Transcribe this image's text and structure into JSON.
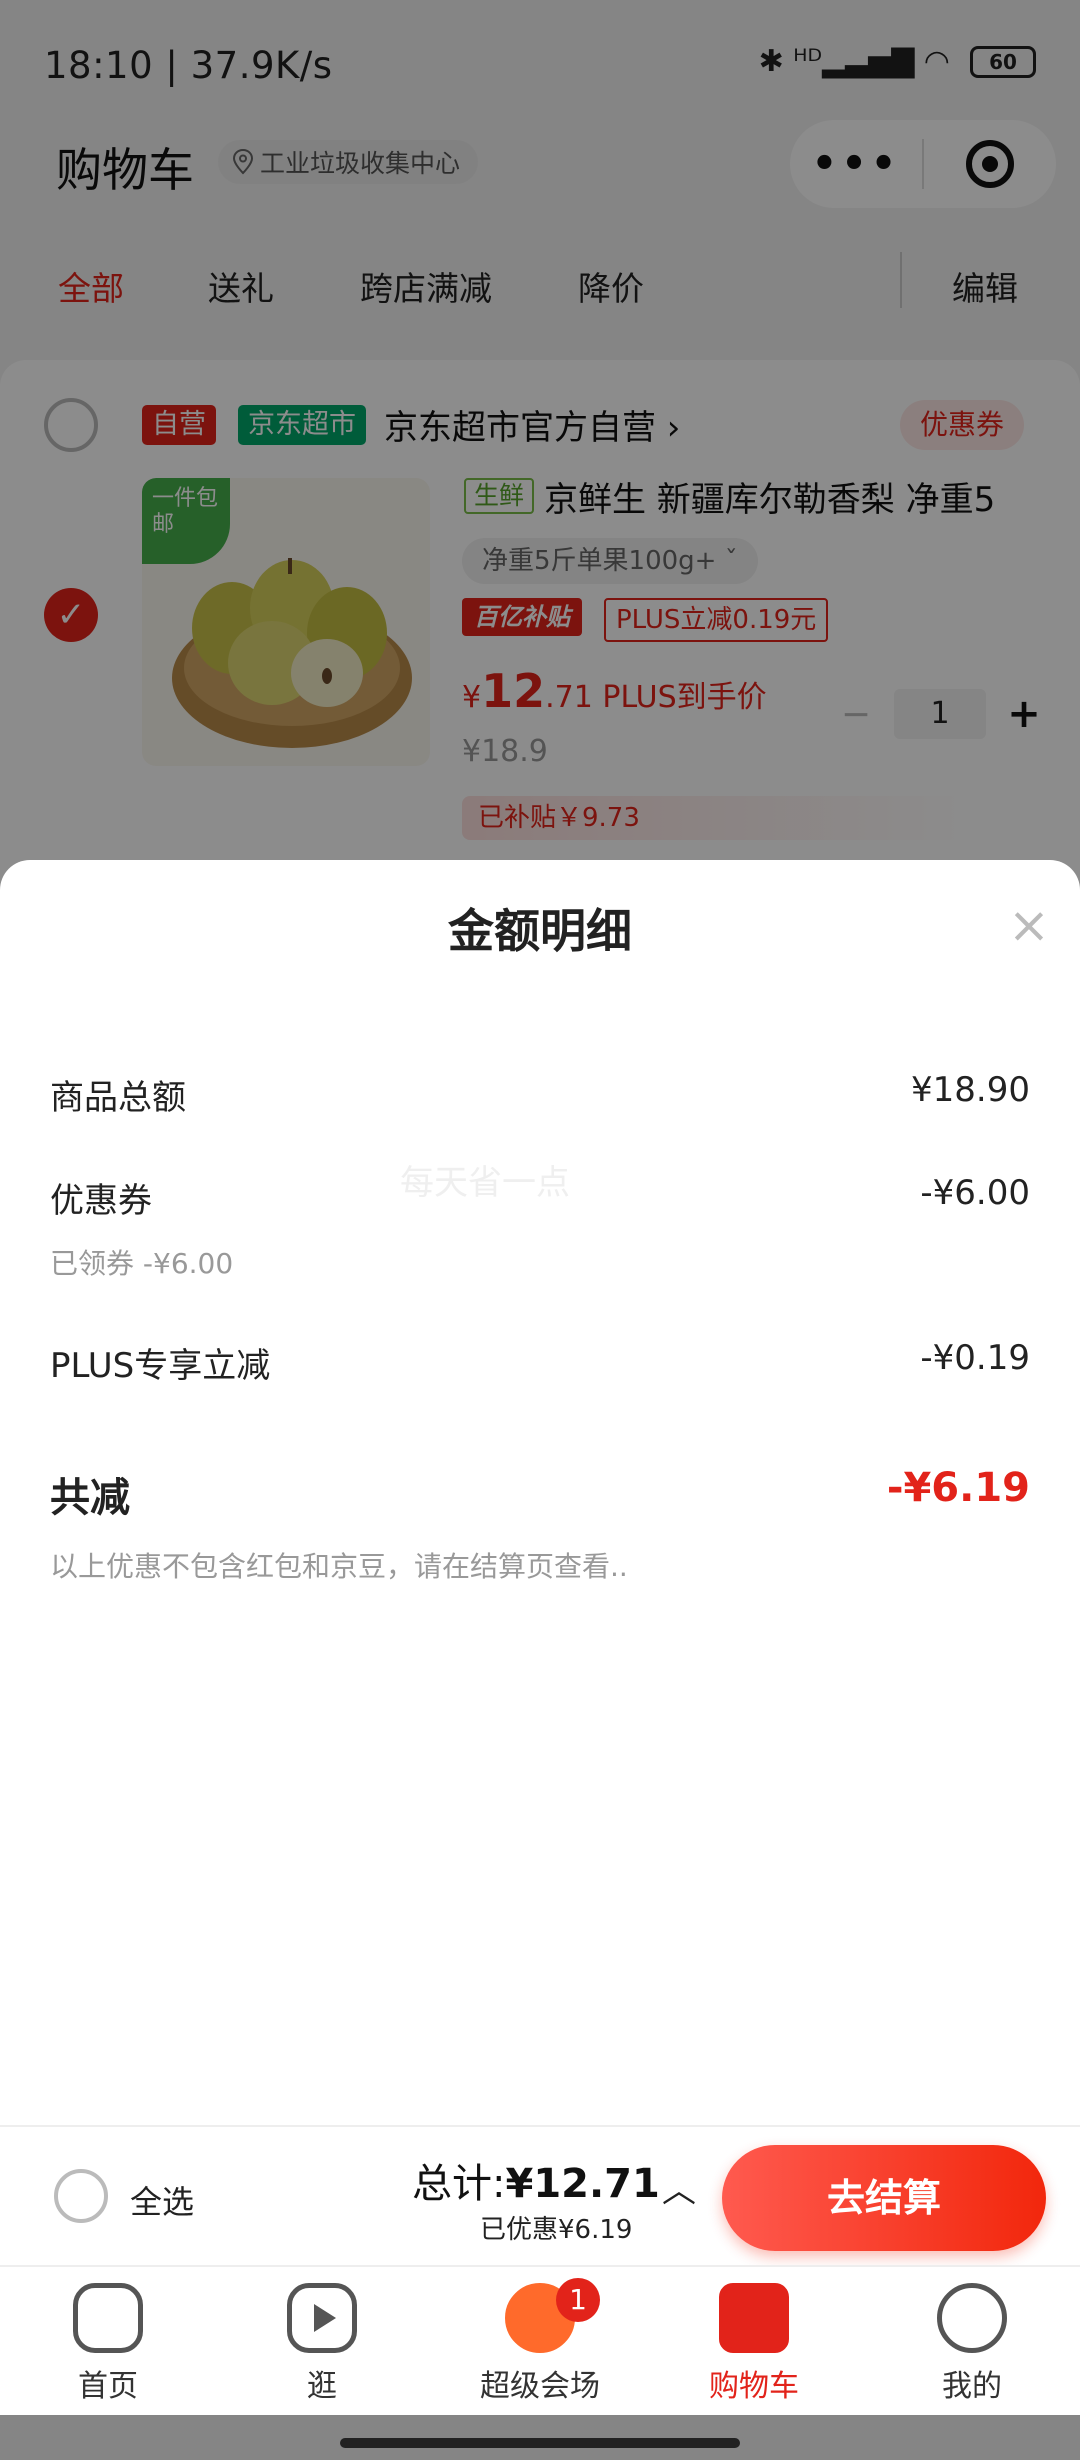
{
  "status_bar": {
    "time": "18:10 | 37.9K/s",
    "network_icons": "✱ ᴴᴰ▂▃▅▇ ◠",
    "battery": "60"
  },
  "header": {
    "title": "购物车",
    "location": "工业垃圾收集中心",
    "menu_dots": "•••"
  },
  "tabs": [
    {
      "label": "全部",
      "active": true
    },
    {
      "label": "送礼"
    },
    {
      "label": "跨店满减"
    },
    {
      "label": "降价"
    },
    {
      "label": "编辑"
    }
  ],
  "store": {
    "self_tag": "自营",
    "brand_tag": "京东超市",
    "name": "京东超市官方自营 ›",
    "coupon": "优惠券",
    "checkmark": "✓"
  },
  "product": {
    "free_shipping": "一件包邮",
    "fresh_tag": "生鲜",
    "title": "京鲜生 新疆库尔勒香梨 净重5",
    "spec": "净重5斤单果100g+  ˇ",
    "subsidy_logo": "百亿补贴",
    "plus_tag": "PLUS立减0.19元",
    "price_symbol": "¥",
    "price_int": "12",
    "price_dec": ".71",
    "price_label": " PLUS到手价",
    "original_price": "¥18.9",
    "qty_minus": "−",
    "quantity": "1",
    "qty_plus": "+",
    "subsidy": "已补贴￥9.73"
  },
  "sheet": {
    "title": "金额明细",
    "close": "×",
    "watermark": "每天省一点",
    "rows": [
      {
        "label": "商品总额",
        "value": "¥18.90"
      },
      {
        "label": "优惠券",
        "value": "-¥6.00",
        "sub": "已领券 -¥6.00"
      },
      {
        "label": "PLUS专享立减",
        "value": "-¥0.19"
      }
    ],
    "total_label": "共减",
    "total_value": "-¥6.19",
    "note": "以上优惠不包含红包和京豆，请在结算页查看.."
  },
  "bottom_bar": {
    "select_all": "全选",
    "total_prefix": "总计:",
    "total": "¥12.71",
    "saved": "已优惠¥6.19",
    "chevron": "︿",
    "checkout": "去结算"
  },
  "nav": [
    {
      "label": "首页",
      "icon": "home-icon"
    },
    {
      "label": "逛",
      "icon": "video-play-icon"
    },
    {
      "label": "超级会场",
      "icon": "super-venue-icon",
      "badge": "1"
    },
    {
      "label": "购物车",
      "icon": "cart-icon",
      "active": true
    },
    {
      "label": "我的",
      "icon": "smiley-face-icon"
    }
  ],
  "colors": {
    "accent": "#e2231a",
    "jd_green": "#00a86b",
    "fresh_green": "#45b04c"
  }
}
